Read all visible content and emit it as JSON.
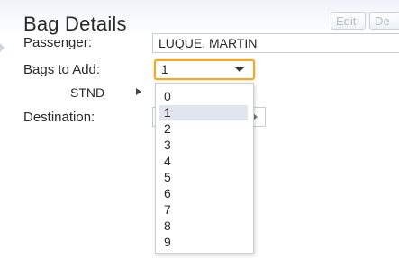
{
  "header": {
    "title": "Bag Details",
    "edit_label": "Edit",
    "second_label": "De"
  },
  "form": {
    "passenger_label": "Passenger:",
    "passenger_value": "LUQUE, MARTIN",
    "bags_label": "Bags to Add:",
    "bags_value": "1",
    "stnd_label": "STND",
    "destination_label": "Destination:"
  },
  "dropdown": {
    "options": [
      "0",
      "1",
      "2",
      "3",
      "4",
      "5",
      "6",
      "7",
      "8",
      "9"
    ],
    "selected": "1"
  },
  "colors": {
    "focus_border": "#f5a623",
    "selected_option": "#e1e6ee"
  },
  "icons": {
    "stnd_expand": "triangle-right-icon",
    "select_caret": "chevron-down-icon",
    "left_tab": "triangle-right-icon"
  }
}
